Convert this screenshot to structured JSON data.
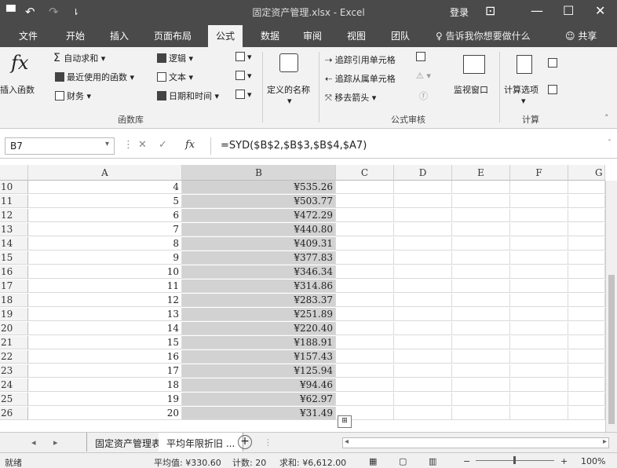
{
  "titlebar": {
    "title": "固定资产管理.xlsx - Excel",
    "login": "登录",
    "save_icon": "▀",
    "undo_icon": "↶",
    "redo_icon": "↷",
    "customize_icon": "⇂",
    "ribbon_display_icon": "⊡",
    "minimize_icon": "—",
    "restore_icon": "☐",
    "close_icon": "✕"
  },
  "tabs": [
    "文件",
    "开始",
    "插入",
    "页面布局",
    "公式",
    "数据",
    "审阅",
    "视图",
    "团队"
  ],
  "active_tab": "公式",
  "tell_me": "告诉我你想要做什么",
  "share": "共享",
  "ribbon": {
    "insert_function": "插入函数",
    "autosum": "自动求和",
    "recent": "最近使用的函数",
    "financial": "财务",
    "logical": "逻辑",
    "text": "文本",
    "datetime": "日期和时间",
    "library_label": "函数库",
    "define_name": "定义的名称",
    "trace_precedents": "追踪引用单元格",
    "trace_dependents": "追踪从属单元格",
    "remove_arrows": "移去箭头",
    "audit_label": "公式审核",
    "watch_window": "监视窗口",
    "calc_options": "计算选项",
    "calc_label": "计算"
  },
  "formulabar": {
    "name_box": "B7",
    "fx": "fx",
    "formula": "=SYD($B$2,$B$3,$B$4,$A7)"
  },
  "columns": [
    "A",
    "B",
    "C",
    "D",
    "E",
    "F",
    "G"
  ],
  "rows": [
    {
      "num": "10",
      "a": "4",
      "b": "¥535.26"
    },
    {
      "num": "11",
      "a": "5",
      "b": "¥503.77"
    },
    {
      "num": "12",
      "a": "6",
      "b": "¥472.29"
    },
    {
      "num": "13",
      "a": "7",
      "b": "¥440.80"
    },
    {
      "num": "14",
      "a": "8",
      "b": "¥409.31"
    },
    {
      "num": "15",
      "a": "9",
      "b": "¥377.83"
    },
    {
      "num": "16",
      "a": "10",
      "b": "¥346.34"
    },
    {
      "num": "17",
      "a": "11",
      "b": "¥314.86"
    },
    {
      "num": "18",
      "a": "12",
      "b": "¥283.37"
    },
    {
      "num": "19",
      "a": "13",
      "b": "¥251.89"
    },
    {
      "num": "20",
      "a": "14",
      "b": "¥220.40"
    },
    {
      "num": "21",
      "a": "15",
      "b": "¥188.91"
    },
    {
      "num": "22",
      "a": "16",
      "b": "¥157.43"
    },
    {
      "num": "23",
      "a": "17",
      "b": "¥125.94"
    },
    {
      "num": "24",
      "a": "18",
      "b": "¥94.46"
    },
    {
      "num": "25",
      "a": "19",
      "b": "¥62.97"
    },
    {
      "num": "26",
      "a": "20",
      "b": "¥31.49"
    }
  ],
  "sheets": [
    "固定资产管理表",
    "平均年限折旧 ..."
  ],
  "status": {
    "ready": "就绪",
    "average": "平均值: ¥330.60",
    "count": "计数: 20",
    "sum": "求和: ¥6,612.00",
    "zoom": "100%"
  }
}
